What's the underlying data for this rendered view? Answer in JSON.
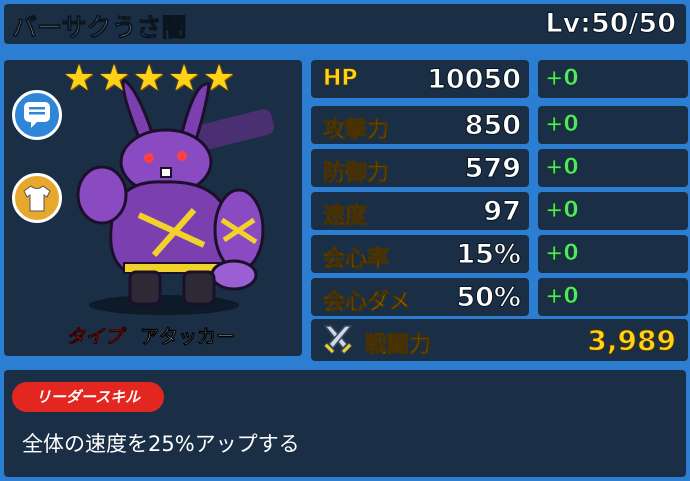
{
  "header": {
    "name": "バーサクうさ闇",
    "level": "Lv:50/50"
  },
  "portrait": {
    "star_count": 5,
    "star_color": "#ffd21a",
    "type_label": "タイプ",
    "type_value": "アタッカー",
    "buttons": {
      "chat_icon": "chat-bubble-icon",
      "equipment_icon": "shirt-icon"
    }
  },
  "stats": [
    {
      "label": "HP",
      "value": "10050",
      "bonus": "+0"
    },
    {
      "label": "攻撃力",
      "value": "850",
      "bonus": "+0"
    },
    {
      "label": "防御力",
      "value": "579",
      "bonus": "+0"
    },
    {
      "label": "速度",
      "value": "97",
      "bonus": "+0"
    },
    {
      "label": "会心率",
      "value": "15%",
      "bonus": "+0"
    },
    {
      "label": "会心ダメ",
      "value": "50%",
      "bonus": "+0"
    }
  ],
  "power": {
    "label": "戦闘力",
    "value": "3,989"
  },
  "leader_skill": {
    "tag": "リーダースキル",
    "description": "全体の速度を25%アップする"
  },
  "colors": {
    "background": "#2b7ed1",
    "panel": "#1a2f45",
    "label_yellow": "#ffd21a",
    "bonus_green": "#55e36a",
    "type_red": "#ff3a2f",
    "skill_tag_red": "#e3261f"
  }
}
